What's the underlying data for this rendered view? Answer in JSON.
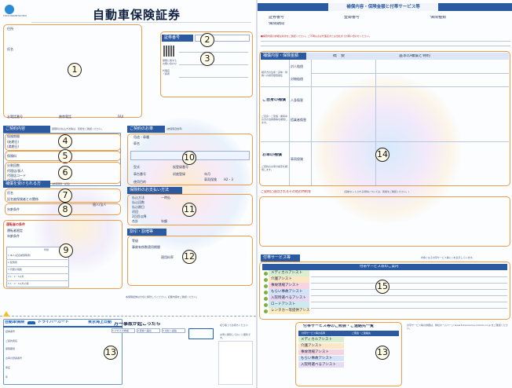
{
  "left_page": {
    "company_logo_text": "TOKIO MARINE NICHIDO",
    "title": "自動車保険証券",
    "holder_fields": {
      "address_label": "住所",
      "name_label": "氏名",
      "phone_label": "お電話番号",
      "mobile_label": "携帯電話",
      "fax_label": "FAX"
    },
    "cert_no_label": "証券番号",
    "contact": {
      "line1": "保険に関する",
      "line2": "お問い合わせ",
      "line3": "代理店",
      "line4": "・扱者"
    },
    "contract": {
      "header": "ご契約内容",
      "header_note": "保険料の払込方法等は、別紙をご確認ください。",
      "period_label": "保険期間",
      "period_from": "(始期日)",
      "period_to": "(満期日)",
      "premium_label": "保険料",
      "installment_label": "分割回数",
      "agent_label": "代理店/扱人",
      "agent_code_label": "代理店コード",
      "agent_office_label": "代理店住所"
    },
    "insured": {
      "header": "補償を受けられる方",
      "header_note": "(被保険者・記名)",
      "name_label": "氏名",
      "relation_label": "記名被保険者との関係",
      "age_label": "年齢条件",
      "person_label": "個人/法人"
    },
    "driver": {
      "header": "運転者の条件",
      "rows": [
        "運転者限定",
        "年齢条件"
      ],
      "table_header": "年齢",
      "table_rows": [
        "1 本人(記名被保険者)",
        "2 配偶者",
        "3 同居の親族",
        "4 1・2・3以外",
        "5 1・2・3以外の者"
      ]
    },
    "vehicle": {
      "header": "ご契約のお車",
      "header_note": "(被保険自動車)",
      "rows": [
        "用途・車種",
        "車名",
        "型式",
        "登録番号",
        "車台番号",
        "仮登録番号",
        "初度登録",
        "使用目的"
      ],
      "extra_labels": [
        "年月",
        "車両保険",
        "H2・3"
      ]
    },
    "premium": {
      "header": "保険料のお支払い方法",
      "rows": [
        "払込方法",
        "払込回数",
        "払込期日",
        "初回",
        "2回目以降",
        "合計"
      ],
      "extra_labels": [
        "一時払",
        "年額"
      ]
    },
    "discount": {
      "header": "割引・割増等",
      "rows": [
        "等級",
        "事故有係数適用期間",
        "",
        "適用料率"
      ]
    },
    "footer_note": "本保険証券は大切に保管してください。記載内容をご確認ください。",
    "card": {
      "brand": "自動車保険",
      "card_title": "ドライバーカード",
      "company": "東京海上日動",
      "fields": [
        "証券番号",
        "ご契約者名",
        "保険期間",
        "お車の登録番号",
        "車名",
        "年"
      ]
    },
    "accident": {
      "title": "万一事故が起こったら",
      "steps": [
        "1.けが人の救護",
        "2.警察へ届出",
        "3.当社へ連絡"
      ]
    },
    "cut_notes": [
      "切り取ってお持ちください",
      "お車に保管しておくと便利です。"
    ]
  },
  "right_page": {
    "header": "補償内容・保険金額と付帯サービス等",
    "cert_labels": [
      "証券番号",
      "登録番号",
      "保険期間"
    ],
    "insured_label": "保険種類",
    "notice": "■補償内容の詳細は約款をご確認ください。ご不明な点は代理店または当社までお問い合わせください。",
    "coverage": {
      "header": "補償内容・保険金額",
      "col_overview": "概　要",
      "col_basic": "基本の補償と特約",
      "row_groups": [
        {
          "title": "相手方への賠償",
          "items": [
            "対人賠償",
            "対物賠償"
          ]
        },
        {
          "title": "ご自身の補償",
          "items": [
            "人身傷害",
            "搭乗者傷害"
          ]
        },
        {
          "title": "お車の補償",
          "items": [
            "車両保険"
          ]
        }
      ],
      "side_texts": [
        "相手方の生命・身体・財物への損害賠償責任",
        "ご自身・ご家族・乗車中の方の治療費等を補償します。",
        "ご契約のお車の損害を補償します。"
      ],
      "other_row": "ご契約に適用されるその他の特約等"
    },
    "other_header": "ご契約に適用されるその他の特約等",
    "other_note": "(自動セットされる特約については、別紙をご確認ください。)",
    "services": {
      "header": "付帯サービス等",
      "intro": "対象となる付帯サービス等に○を表示しています。",
      "table_header": "付帯サービス等のご案内",
      "items": [
        {
          "name": "メディカルアシスト",
          "color": "#3aa64a"
        },
        {
          "name": "介護アシスト",
          "color": "#e9a23b"
        },
        {
          "name": "事故現場アシスト",
          "color": "#e05a8a"
        },
        {
          "name": "もらい事故アシスト",
          "color": "#5b8dd6"
        },
        {
          "name": "入院時選べるアシスト",
          "color": "#9b6fc4"
        },
        {
          "name": "ロードアシスト",
          "color": "#2f9fb0"
        },
        {
          "name": "レンタカー等提供アシスト",
          "color": "#f0b429"
        }
      ]
    },
    "contact_block": {
      "title": "付帯サービス等のご照会・ご連絡先一覧",
      "col_name": "付帯サービス等の名称",
      "col_contact": "ご照会・ご連絡先",
      "items": [
        "メディカルアシスト",
        "介護アシスト",
        "事故現場アシスト",
        "もらい事故アシスト",
        "入院時選べるアシスト"
      ],
      "side_note": "付帯サービス等の詳細は、弊社ホームページ www.tokiomarine-nichido.co.jp をご確認ください。"
    }
  },
  "markers": [
    "1",
    "2",
    "3",
    "4",
    "5",
    "6",
    "7",
    "8",
    "9",
    "10",
    "11",
    "12",
    "13",
    "14",
    "15",
    "13"
  ],
  "colors": {
    "navy": "#2c5aa0",
    "orange_outline": "#ef9b4c",
    "service_green": "#7bb242",
    "card_blue": "#1f5fbf"
  }
}
